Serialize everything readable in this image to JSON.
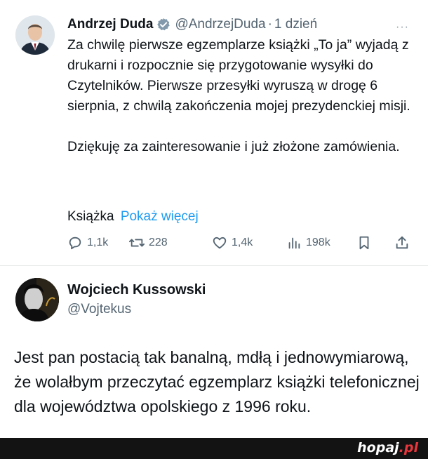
{
  "tweet": {
    "author_name": "Andrzej Duda",
    "handle": "@AndrzejDuda",
    "separator": "·",
    "time": "1 dzień",
    "more": "···",
    "paragraphs": [
      "Za chwilę pierwsze egzemplarze książki „To ja” wyjadą z drukarni i rozpocznie się przygotowanie wysyłki do Czytelników. Pierwsze przesyłki wyruszą w drogę 6 sierpnia, z chwilą zakończenia mojej prezydenckiej misji.",
      "Dziękuję za zainteresowanie i już złożone zamówienia."
    ],
    "link_label": "Książka",
    "show_more": "Pokaż więcej",
    "stats": {
      "replies": "1,1k",
      "retweets": "228",
      "likes": "1,4k",
      "views": "198k"
    }
  },
  "reply": {
    "author_name": "Wojciech Kussowski",
    "handle": "@Vojtekus",
    "text": "Jest pan postacią tak banalną, mdłą i jednowymiarową, że wolałbym przeczytać egzemplarz książki telefonicznej dla województwa opolskiego z  1996 roku."
  },
  "footer": {
    "brand": "hopaj",
    "brand_ext": ".pl"
  },
  "colors": {
    "link": "#1d9bf0",
    "muted": "#536471",
    "text": "#0f1419",
    "footer_bg": "#131313",
    "brand_accent": "#e8363c"
  },
  "icons": [
    "verified-badge-icon",
    "reply-icon",
    "retweet-icon",
    "like-icon",
    "views-icon",
    "bookmark-icon",
    "share-icon"
  ]
}
